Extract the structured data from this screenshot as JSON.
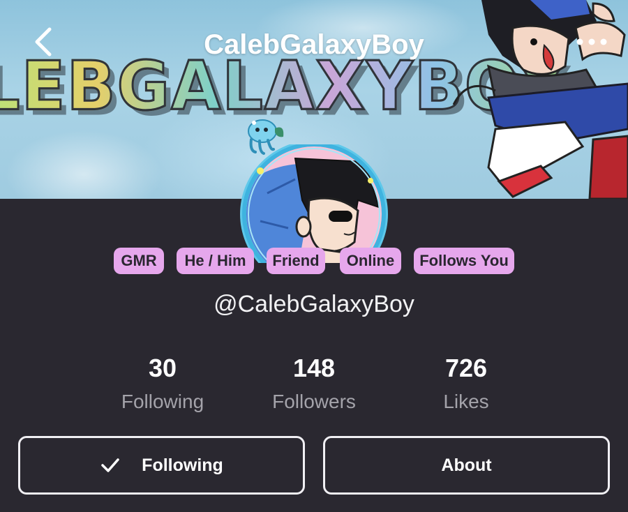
{
  "header": {
    "title": "CalebGalaxyBoy",
    "back_icon": "chevron-left-icon",
    "more_icon": "more-horizontal-icon"
  },
  "banner": {
    "text": "LEBGALAXYBOY"
  },
  "profile": {
    "handle": "@CalebGalaxyBoy",
    "tags": [
      "GMR",
      "He / Him",
      "Friend",
      "Online",
      "Follows You"
    ]
  },
  "stats": [
    {
      "value": "30",
      "label": "Following"
    },
    {
      "value": "148",
      "label": "Followers"
    },
    {
      "value": "726",
      "label": "Likes"
    }
  ],
  "actions": {
    "following_label": "Following",
    "following_icon": "checkmark-icon",
    "about_label": "About"
  },
  "colors": {
    "background": "#2a2830",
    "tag_bg": "#e6a7ec",
    "tag_text": "#2a2630",
    "text_primary": "#ffffff",
    "text_muted": "#a4a3aa"
  }
}
